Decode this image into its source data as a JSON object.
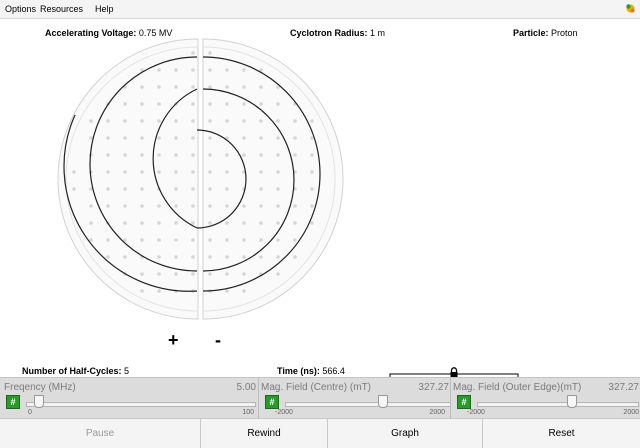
{
  "menu": {
    "items": [
      "Options",
      "Resources",
      "Help"
    ]
  },
  "info": {
    "voltage_label": "Accelerating Voltage:",
    "voltage_value": "0.75 MV",
    "radius_label": "Cyclotron Radius:",
    "radius_value": "1 m",
    "particle_label": "Particle:",
    "particle_value": "Proton"
  },
  "electrodes": {
    "plus": "+",
    "minus": "-"
  },
  "status": {
    "halfcycles_label": "Number of Half-Cycles:",
    "halfcycles_value": "5",
    "time_label": "Time (ns):",
    "time_value": "566.4"
  },
  "controls": [
    {
      "label": "Freqency (MHz)",
      "value": "5.00",
      "min": "0",
      "max": "100",
      "position": 0.05
    },
    {
      "label": "Mag. Field (Centre) (mT)",
      "value": "327.27",
      "min": "-2000",
      "max": "2000",
      "position": 0.582
    },
    {
      "label": "Mag. Field (Outer Edge)(mT)",
      "value": "327.27",
      "min": "-2000",
      "max": "2000",
      "position": 0.582
    }
  ],
  "hash_symbol": "#",
  "buttons": {
    "pause": "Pause",
    "rewind": "Rewind",
    "graph": "Graph",
    "reset": "Reset"
  },
  "colors": {
    "accent_green": "#2a9a2a",
    "panel": "#dcdcdc",
    "trace": "#222222"
  }
}
